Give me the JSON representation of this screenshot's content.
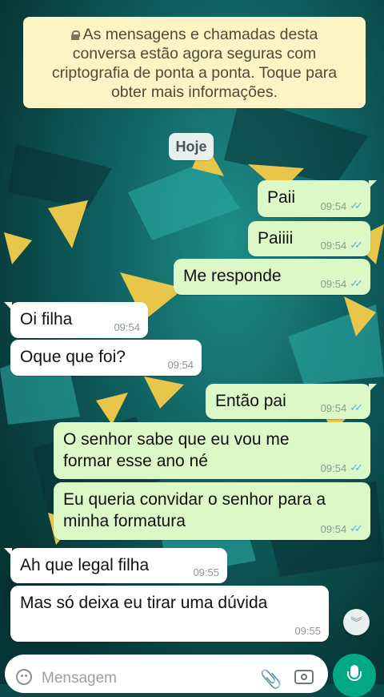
{
  "encryption_banner": {
    "line1": "As mensagens e chamadas desta",
    "line2": "conversa estão agora seguras com",
    "line3": "criptografia de ponta a ponta. Toque para",
    "line4": "obter mais informações."
  },
  "date_chip": "Hoje",
  "messages": [
    {
      "dir": "out",
      "lines": [
        "Paii"
      ],
      "time": "09:54"
    },
    {
      "dir": "out",
      "lines": [
        "Paiiii"
      ],
      "time": "09:54"
    },
    {
      "dir": "out",
      "lines": [
        "Me responde"
      ],
      "time": "09:54"
    },
    {
      "dir": "in",
      "lines": [
        "Oi filha"
      ],
      "time": "09:54"
    },
    {
      "dir": "in",
      "lines": [
        "Oque que foi?"
      ],
      "time": "09:54"
    },
    {
      "dir": "out",
      "lines": [
        "Então pai"
      ],
      "time": "09:54"
    },
    {
      "dir": "out",
      "lines": [
        "O senhor sabe que eu vou me",
        "formar esse ano né"
      ],
      "time": "09:54"
    },
    {
      "dir": "out",
      "lines": [
        "Eu queria convidar o senhor para a",
        "minha formatura"
      ],
      "time": "09:54"
    },
    {
      "dir": "in",
      "lines": [
        "Ah que legal filha"
      ],
      "time": "09:55"
    },
    {
      "dir": "in",
      "lines": [
        "Mas só deixa eu tirar uma dúvida"
      ],
      "time": "09:55"
    }
  ],
  "composer": {
    "placeholder": "Mensagem"
  },
  "colors": {
    "outgoing_bubble": "#dcf8c6",
    "incoming_bubble": "#ffffff",
    "read_ticks": "#4fb6ec",
    "mic_button": "#00a884",
    "banner": "#fdf4c5"
  }
}
